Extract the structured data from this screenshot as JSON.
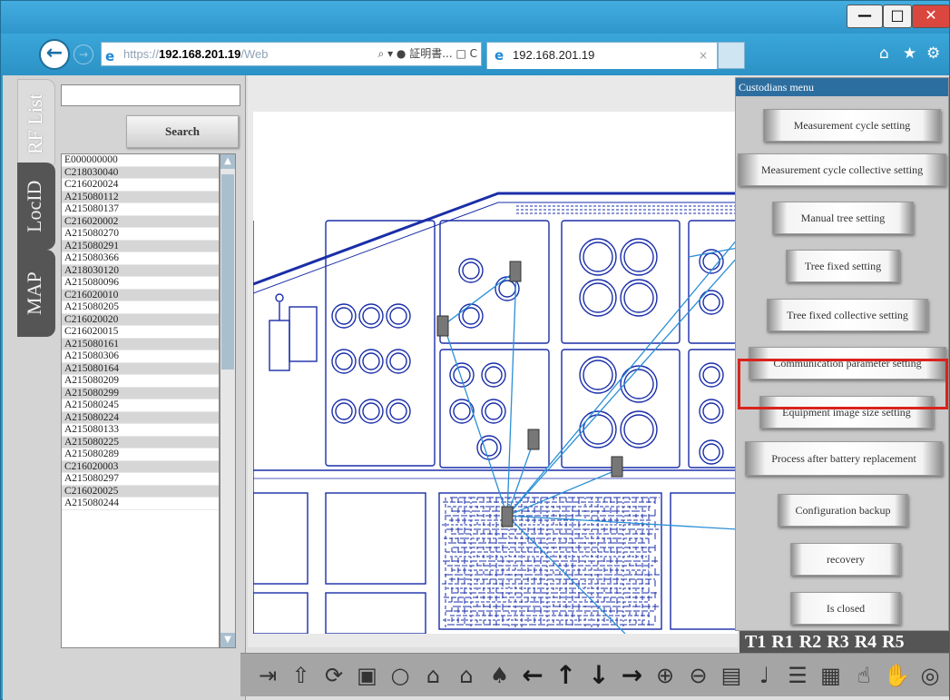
{
  "browser": {
    "url_prefix": "https://",
    "url_host": "192.168.201.19",
    "url_suffix": "/Web",
    "url_controls": "⌕ ▾ ● 証明書... □ C",
    "tab_title": "192.168.201.19",
    "tab_close": "×"
  },
  "left_tabs": [
    "RF List",
    "LocID",
    "MAP"
  ],
  "search": {
    "value": "",
    "button_label": "Search"
  },
  "rf_list": [
    "E000000000",
    "C218030040",
    "C216020024",
    "A215080112",
    "A215080137",
    "C216020002",
    "A215080270",
    "A215080291",
    "A215080366",
    "A218030120",
    "A215080096",
    "C216020010",
    "A215080205",
    "C216020020",
    "C216020015",
    "A215080161",
    "A215080306",
    "A215080164",
    "A215080209",
    "A215080299",
    "A215080245",
    "A215080224",
    "A215080133",
    "A215080225",
    "A215080289",
    "C216020003",
    "A215080297",
    "C216020025",
    "A215080244"
  ],
  "custodians_menu": {
    "title": "Custodians menu",
    "items": [
      "Measurement cycle setting",
      "Measurement cycle collective setting",
      "Manual tree setting",
      "Tree fixed setting",
      "Tree fixed collective setting",
      "Communication parameter setting",
      "Equipment image size setting",
      "Process after battery replacement",
      "Configuration backup",
      "recovery",
      "Is closed"
    ],
    "highlighted": "Process after battery replacement"
  },
  "t_bar": [
    "T1",
    "R1",
    "R2",
    "R3",
    "R4",
    "R5"
  ],
  "colors": {
    "menu_title_bg": "#2d6ea0",
    "highlight_border": "#d9231d",
    "map_line": "#1a2ea8",
    "link_line": "#2a8fd6"
  },
  "toolbar_icons": [
    "exit-icon",
    "upload-icon",
    "refresh-icon",
    "screen-icon",
    "pin-icon",
    "bell-icon",
    "bell-outline-icon",
    "tree-icon",
    "arrow-left-icon",
    "arrow-up-icon",
    "arrow-down-icon",
    "arrow-right-icon",
    "zoom-in-icon",
    "zoom-out-icon",
    "window-icon",
    "thermometer-icon",
    "list-icon",
    "table-icon",
    "pointer-icon",
    "hand-icon",
    "globe-icon"
  ]
}
